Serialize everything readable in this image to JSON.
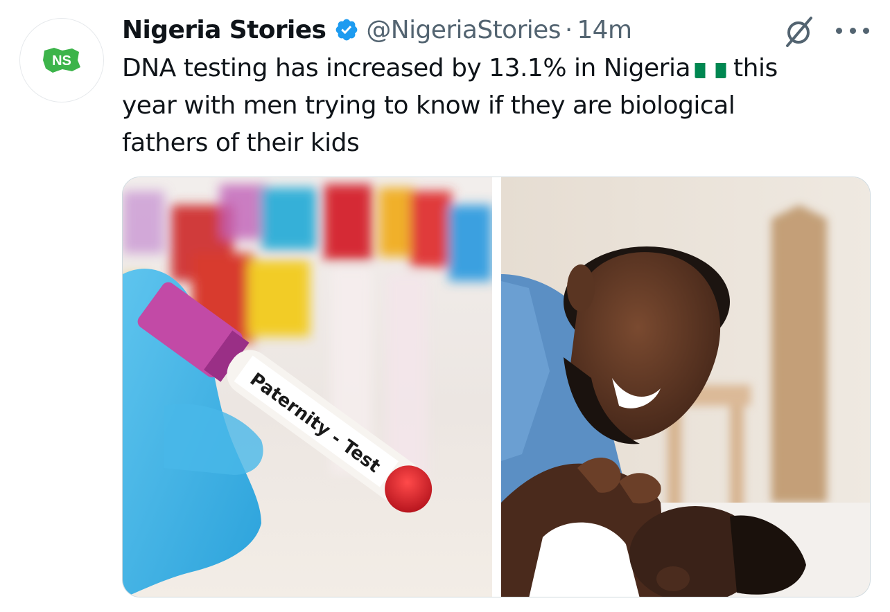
{
  "author": {
    "name": "Nigeria Stories",
    "handle": "@NigeriaStories",
    "separator": "·",
    "time": "14m",
    "avatar_text": "NS",
    "verified_color": "#1d9bf0"
  },
  "tweet": {
    "line1_before_flag": "DNA testing has increased by 13.1%  in Nigeria",
    "line1_after_flag": "this",
    "line2": "year with men trying to know if they are biological",
    "line3": "fathers of their kids"
  },
  "media": {
    "left_label": "Paternity - Test"
  },
  "icons": {
    "verified": "verified-badge-icon",
    "grok": "grok-icon",
    "more": "more-dots-icon",
    "flag": "nigeria-flag-icon"
  },
  "colors": {
    "text": "#0f1419",
    "secondary": "#536471",
    "accent": "#1d9bf0",
    "flag_green": "#008751",
    "logo_green": "#2ea043"
  }
}
